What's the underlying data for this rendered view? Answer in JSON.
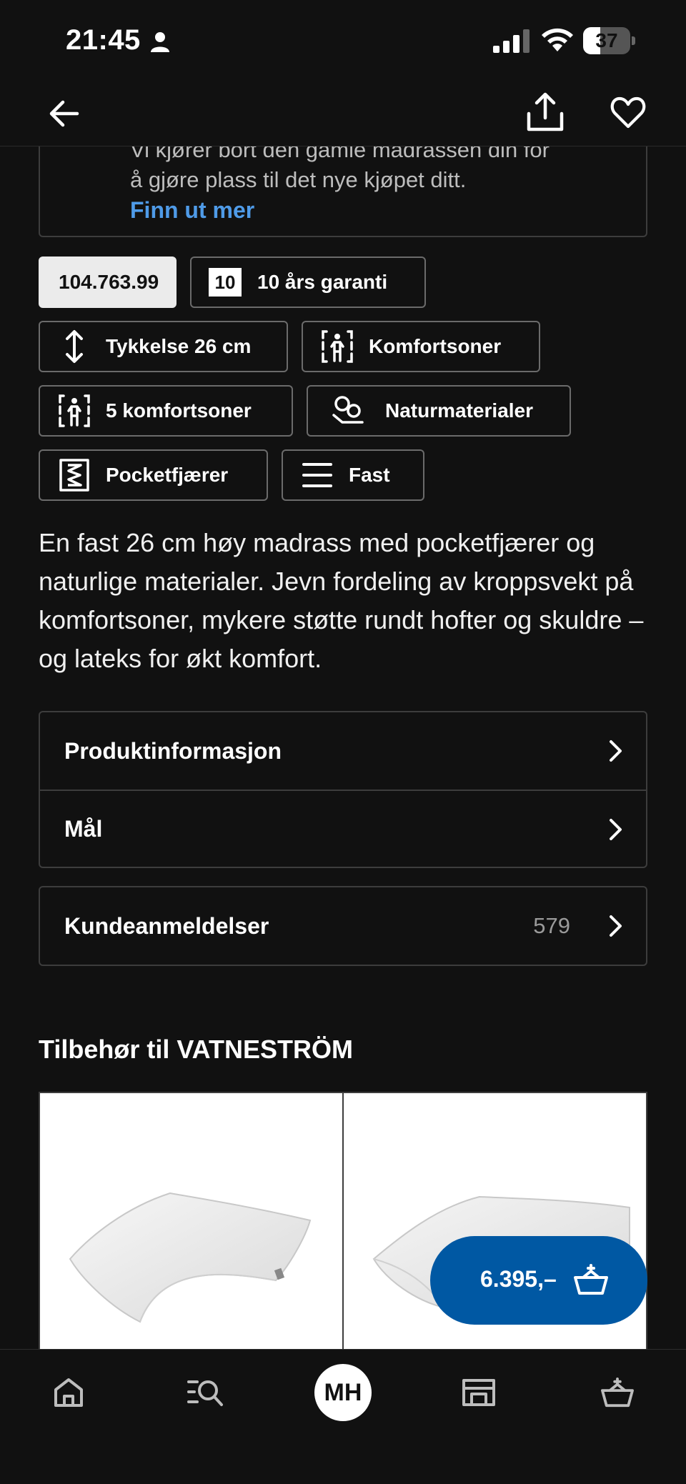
{
  "status_bar": {
    "time": "21:45",
    "battery_level": "37",
    "battery_fraction": 0.37
  },
  "nav": {
    "back_icon": "arrow-left-icon",
    "share_icon": "share-icon",
    "favorite_icon": "heart-icon"
  },
  "service": {
    "line1": "Vi kjører bort den gamle madrassen din for",
    "line2": "å gjøre plass til det nye kjøpet ditt.",
    "link": "Finn ut mer"
  },
  "chips": {
    "article_number": "104.763.99",
    "warranty_badge": "10",
    "warranty": "10 års garanti",
    "thickness": "Tykkelse 26 cm",
    "comfort_zones": "Komfortsoner",
    "five_zones": "5 komfortsoner",
    "natural": "Naturmaterialer",
    "pocket": "Pocketfjærer",
    "firmness": "Fast"
  },
  "description": "En fast 26 cm høy madrass med pocketfjærer og naturlige materialer. Jevn fordeling av kroppsvekt på komfortsoner, mykere støtte rundt hofter og skuldre – og lateks for økt komfort.",
  "accordion": {
    "product_info": "Produktinformasjon",
    "dimensions": "Mål",
    "reviews": "Kundeanmeldelser",
    "reviews_count": "579"
  },
  "accessories": {
    "title": "Tilbehør til VATNESTRÖM"
  },
  "cart": {
    "price": "6.395,–"
  },
  "tabbar": {
    "home_icon": "home-icon",
    "search_icon": "search-list-icon",
    "avatar_initials": "MH",
    "store_icon": "store-icon",
    "basket_icon": "basket-icon"
  },
  "colors": {
    "background": "#111111",
    "link": "#4f9be8",
    "cart_button": "#0058a3"
  }
}
